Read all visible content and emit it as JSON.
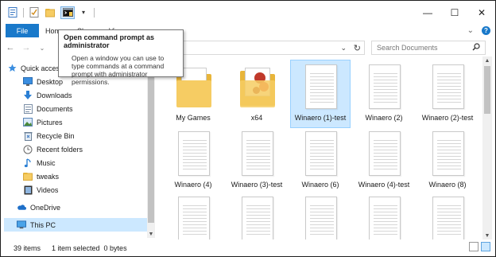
{
  "titlebar": {
    "qat_icons": [
      "properties-icon",
      "checkmark-icon",
      "folder-icon",
      "command-prompt-icon",
      "customize-dropdown-icon"
    ],
    "controls": {
      "minimize": "—",
      "maximize": "☐",
      "close": "✕"
    }
  },
  "ribbon": {
    "file_label": "File",
    "tabs": [
      "Home",
      "Share",
      "View"
    ],
    "expand_icon": "⌄",
    "help_label": "?"
  },
  "address": {
    "back": "←",
    "forward": "→",
    "up_caret": "⌄",
    "dropdown": "⌄",
    "refresh": "↻",
    "search_placeholder": "Search Documents"
  },
  "tooltip": {
    "title": "Open command prompt as administrator",
    "body": "Open a window you can use to type commands at a command prompt with administrator permissions."
  },
  "nav": {
    "items": [
      {
        "label": "Quick access",
        "icon": "star-icon",
        "pinned": false
      },
      {
        "label": "Desktop",
        "icon": "desktop-icon",
        "pinned": true
      },
      {
        "label": "Downloads",
        "icon": "download-icon",
        "pinned": true
      },
      {
        "label": "Documents",
        "icon": "documents-icon",
        "pinned": true
      },
      {
        "label": "Pictures",
        "icon": "pictures-icon",
        "pinned": true
      },
      {
        "label": "Recycle Bin",
        "icon": "recycle-bin-icon",
        "pinned": true
      },
      {
        "label": "Recent folders",
        "icon": "recent-folders-icon",
        "pinned": true
      },
      {
        "label": "Music",
        "icon": "music-icon",
        "pinned": false
      },
      {
        "label": "tweaks",
        "icon": "folder-icon",
        "pinned": false
      },
      {
        "label": "Videos",
        "icon": "videos-icon",
        "pinned": false
      },
      {
        "label": "OneDrive",
        "icon": "onedrive-icon",
        "pinned": false
      },
      {
        "label": "This PC",
        "icon": "this-pc-icon",
        "pinned": false
      }
    ],
    "selected": "This PC"
  },
  "files": [
    {
      "label": "My Games",
      "type": "folder"
    },
    {
      "label": "x64",
      "type": "folder-gear"
    },
    {
      "label": "Winaero (1)-test",
      "type": "doc",
      "selected": true
    },
    {
      "label": "Winaero (2)",
      "type": "doc"
    },
    {
      "label": "Winaero (2)-test",
      "type": "doc"
    },
    {
      "label": "Winaero (4)",
      "type": "doc"
    },
    {
      "label": "Winaero (3)-test",
      "type": "doc"
    },
    {
      "label": "Winaero (6)",
      "type": "doc"
    },
    {
      "label": "Winaero (4)-test",
      "type": "doc"
    },
    {
      "label": "Winaero (8)",
      "type": "doc"
    },
    {
      "label": "",
      "type": "doc"
    },
    {
      "label": "",
      "type": "doc"
    },
    {
      "label": "",
      "type": "doc"
    },
    {
      "label": "",
      "type": "doc"
    },
    {
      "label": "",
      "type": "doc"
    }
  ],
  "status": {
    "count": "39 items",
    "selection": "1 item selected  0 bytes"
  },
  "colors": {
    "accent": "#1979ca",
    "selection": "#cce8ff",
    "folder": "#f6cc63"
  }
}
